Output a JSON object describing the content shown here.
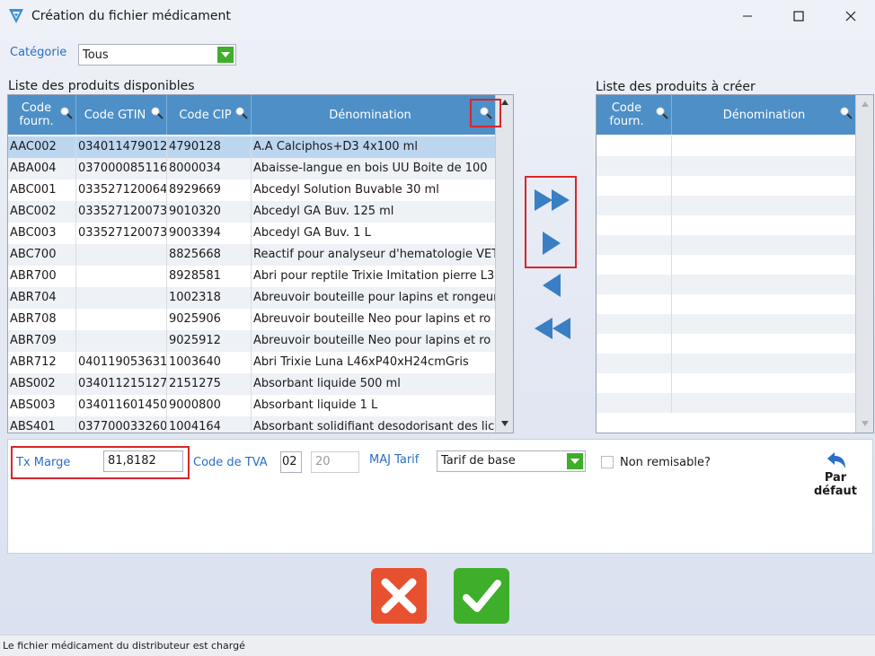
{
  "window": {
    "title": "Création du fichier médicament"
  },
  "categorie": {
    "label": "Catégorie",
    "value": "Tous"
  },
  "available": {
    "title": "Liste des produits disponibles",
    "columns": [
      "Code fourn.",
      "Code GTIN",
      "Code CIP",
      "Dénomination"
    ],
    "rows": [
      [
        "AAC002",
        "034011479012",
        "4790128",
        "A.A Calciphos+D3 4x100 ml"
      ],
      [
        "ABA004",
        "037000085116",
        "8000034",
        "Abaisse-langue en bois UU Boite de 100"
      ],
      [
        "ABC001",
        "033527120064",
        "8929669",
        "Abcedyl Solution Buvable 30 ml"
      ],
      [
        "ABC002",
        "033527120073",
        "9010320",
        "Abcedyl GA Buv. 125 ml"
      ],
      [
        "ABC003",
        "033527120073",
        "9003394",
        "Abcedyl GA Buv. 1 L"
      ],
      [
        "ABC700",
        "",
        "8825668",
        "Reactif pour analyseur d'hematologie VET"
      ],
      [
        "ABR700",
        "",
        "8928581",
        "Abri pour reptile Trixie Imitation pierre L3"
      ],
      [
        "ABR704",
        "",
        "1002318",
        "Abreuvoir bouteille pour lapins et rongeurs"
      ],
      [
        "ABR708",
        "",
        "9025906",
        "Abreuvoir bouteille Neo pour lapins et ro"
      ],
      [
        "ABR709",
        "",
        "9025912",
        "Abreuvoir bouteille Neo pour lapins et ro"
      ],
      [
        "ABR712",
        "040119053631",
        "1003640",
        "Abri Trixie Luna L46xP40xH24cmGris"
      ],
      [
        "ABS002",
        "034011215127",
        "2151275",
        "Absorbant liquide 500 ml"
      ],
      [
        "ABS003",
        "034011601450",
        "9000800",
        "Absorbant liquide 1 L"
      ],
      [
        "ABS401",
        "037700033260",
        "1004164",
        "Absorbant solidifiant desodorisant des lic"
      ]
    ]
  },
  "tocreate": {
    "title": "Liste des produits à créer",
    "columns": [
      "Code fourn.",
      "Dénomination"
    ]
  },
  "form": {
    "tx_marge_label": "Tx Marge",
    "tx_marge_value": "81,8182",
    "code_tva_label": "Code de TVA",
    "code_tva_value": "02",
    "tva_rate": "20",
    "maj_tarif_label": "MAJ Tarif",
    "maj_tarif_value": "Tarif de base",
    "non_remisable_label": "Non remisable?",
    "par_defaut_line1": "Par",
    "par_defaut_line2": "défaut"
  },
  "status": {
    "text": "Le fichier médicament du distributeur est chargé"
  },
  "colors": {
    "accent": "#4d8fc6",
    "green": "#3fae2a",
    "red": "#e8512f",
    "highlight": "#d9262a"
  }
}
